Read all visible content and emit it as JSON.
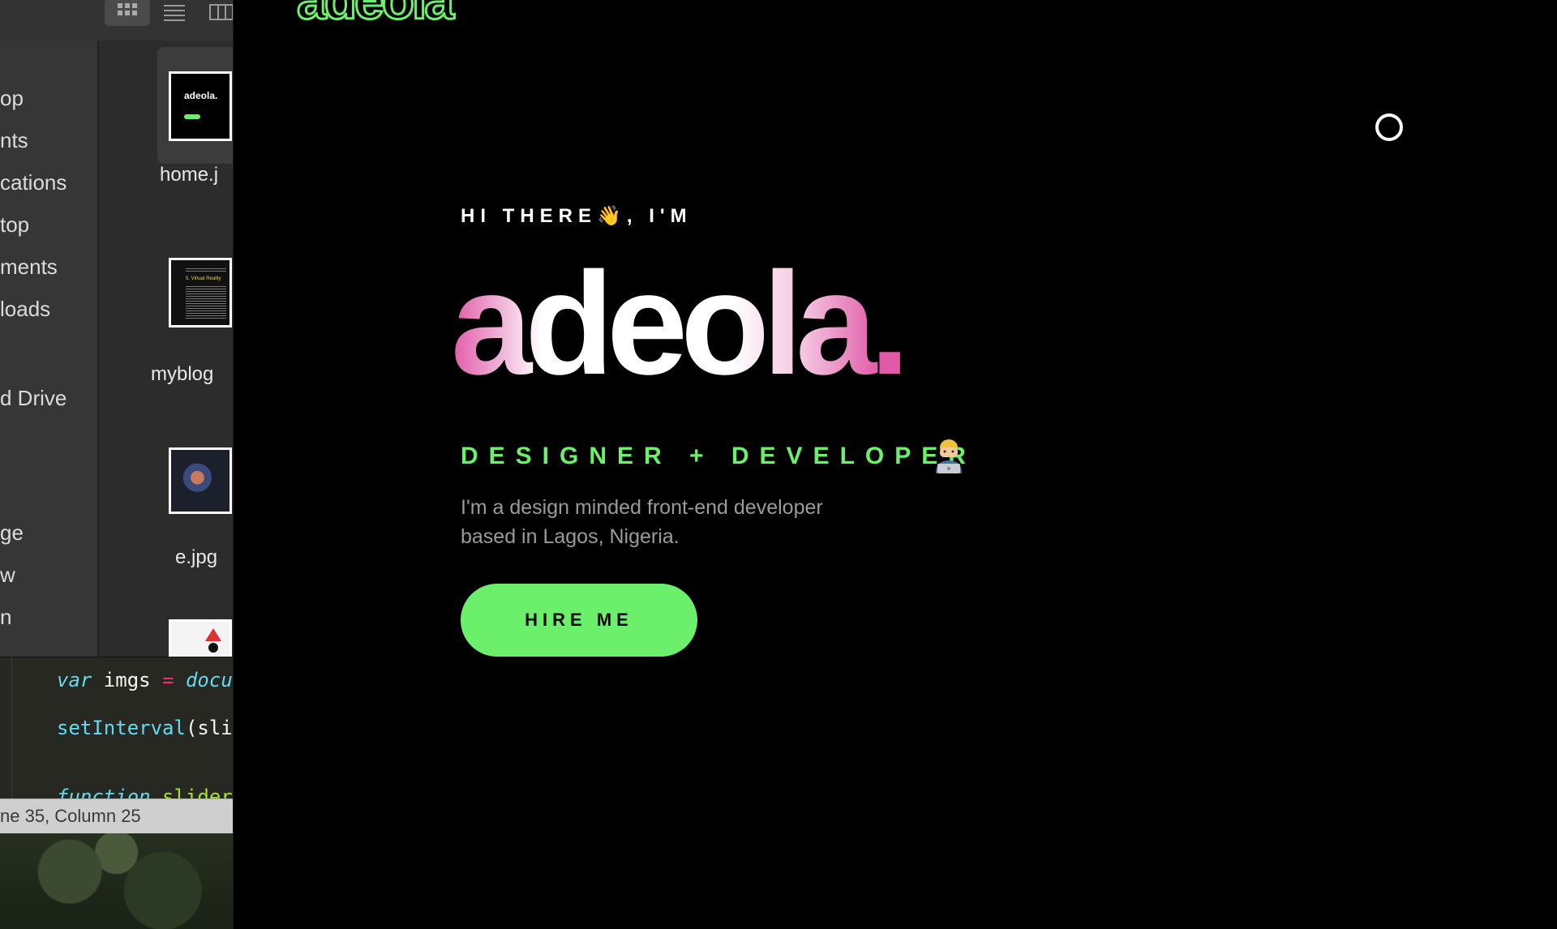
{
  "finder": {
    "sidebar_items": [
      "op",
      "nts",
      "cations",
      "top",
      "ments",
      "loads",
      "d Drive",
      "ge",
      "w",
      "n"
    ],
    "files": [
      {
        "name": "home.j",
        "thumb_text": "adeola."
      },
      {
        "name": "myblog",
        "thumb_text": "5. Virtual Reality"
      },
      {
        "name": "e.jpg",
        "thumb_text": ""
      },
      {
        "name": "",
        "thumb_text": ""
      }
    ]
  },
  "editor": {
    "lines": [
      {
        "keyword": "var",
        "ident": " imgs ",
        "op": "=",
        "rest": " docu"
      },
      {
        "fn": "setInterval",
        "rest": "(sli"
      },
      {
        "fn": "function",
        "rest": " slider"
      }
    ],
    "status": "ne 35, Column 25"
  },
  "portfolio": {
    "logo": "adeola",
    "greeting": "HI THERE👋, I'M",
    "name": "adeola.",
    "role": "DESIGNER + DEVELOPER",
    "bio": "I'm a design minded front-end developer based in Lagos, Nigeria.",
    "cta": "HIRE ME",
    "colors": {
      "accent": "#6cf06c",
      "pink": "#e05aa8",
      "background": "#000000"
    }
  }
}
